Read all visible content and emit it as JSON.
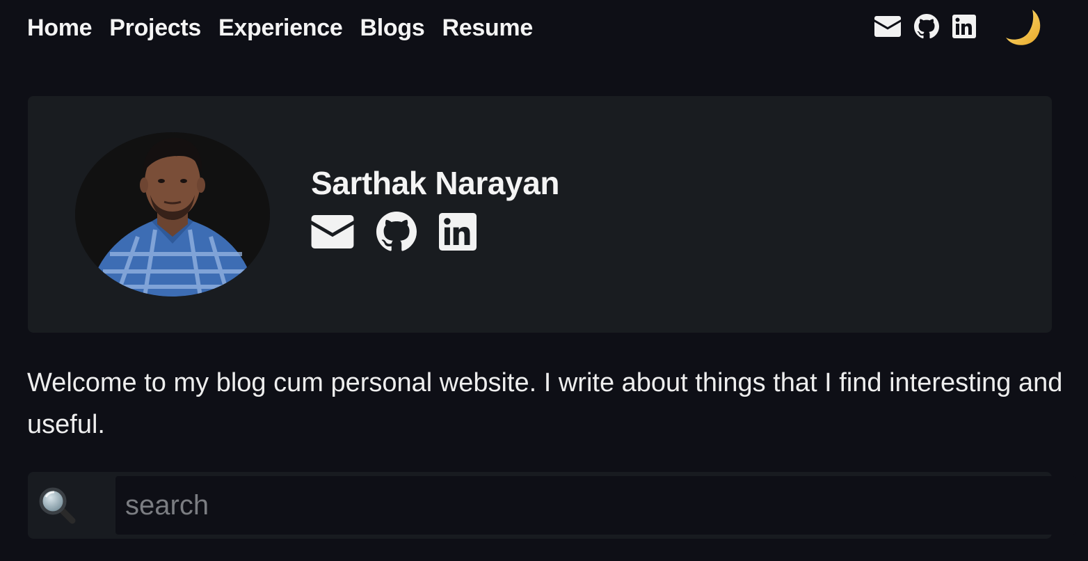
{
  "nav": {
    "links": [
      "Home",
      "Projects",
      "Experience",
      "Blogs",
      "Resume"
    ],
    "icons": [
      "mail-icon",
      "github-icon",
      "linkedin-icon"
    ],
    "theme_toggle_icon": "crescent-moon-icon"
  },
  "profile": {
    "name": "Sarthak Narayan",
    "icons": [
      "mail-icon",
      "github-icon",
      "linkedin-icon"
    ]
  },
  "intro": {
    "text": "Welcome to my blog cum personal website. I write about things that I find interesting and useful."
  },
  "search": {
    "placeholder": "search",
    "value": ""
  },
  "colors": {
    "background": "#0e0f16",
    "card": "#191c20",
    "text": "#f2f2f2",
    "moon": "#f5c542"
  }
}
